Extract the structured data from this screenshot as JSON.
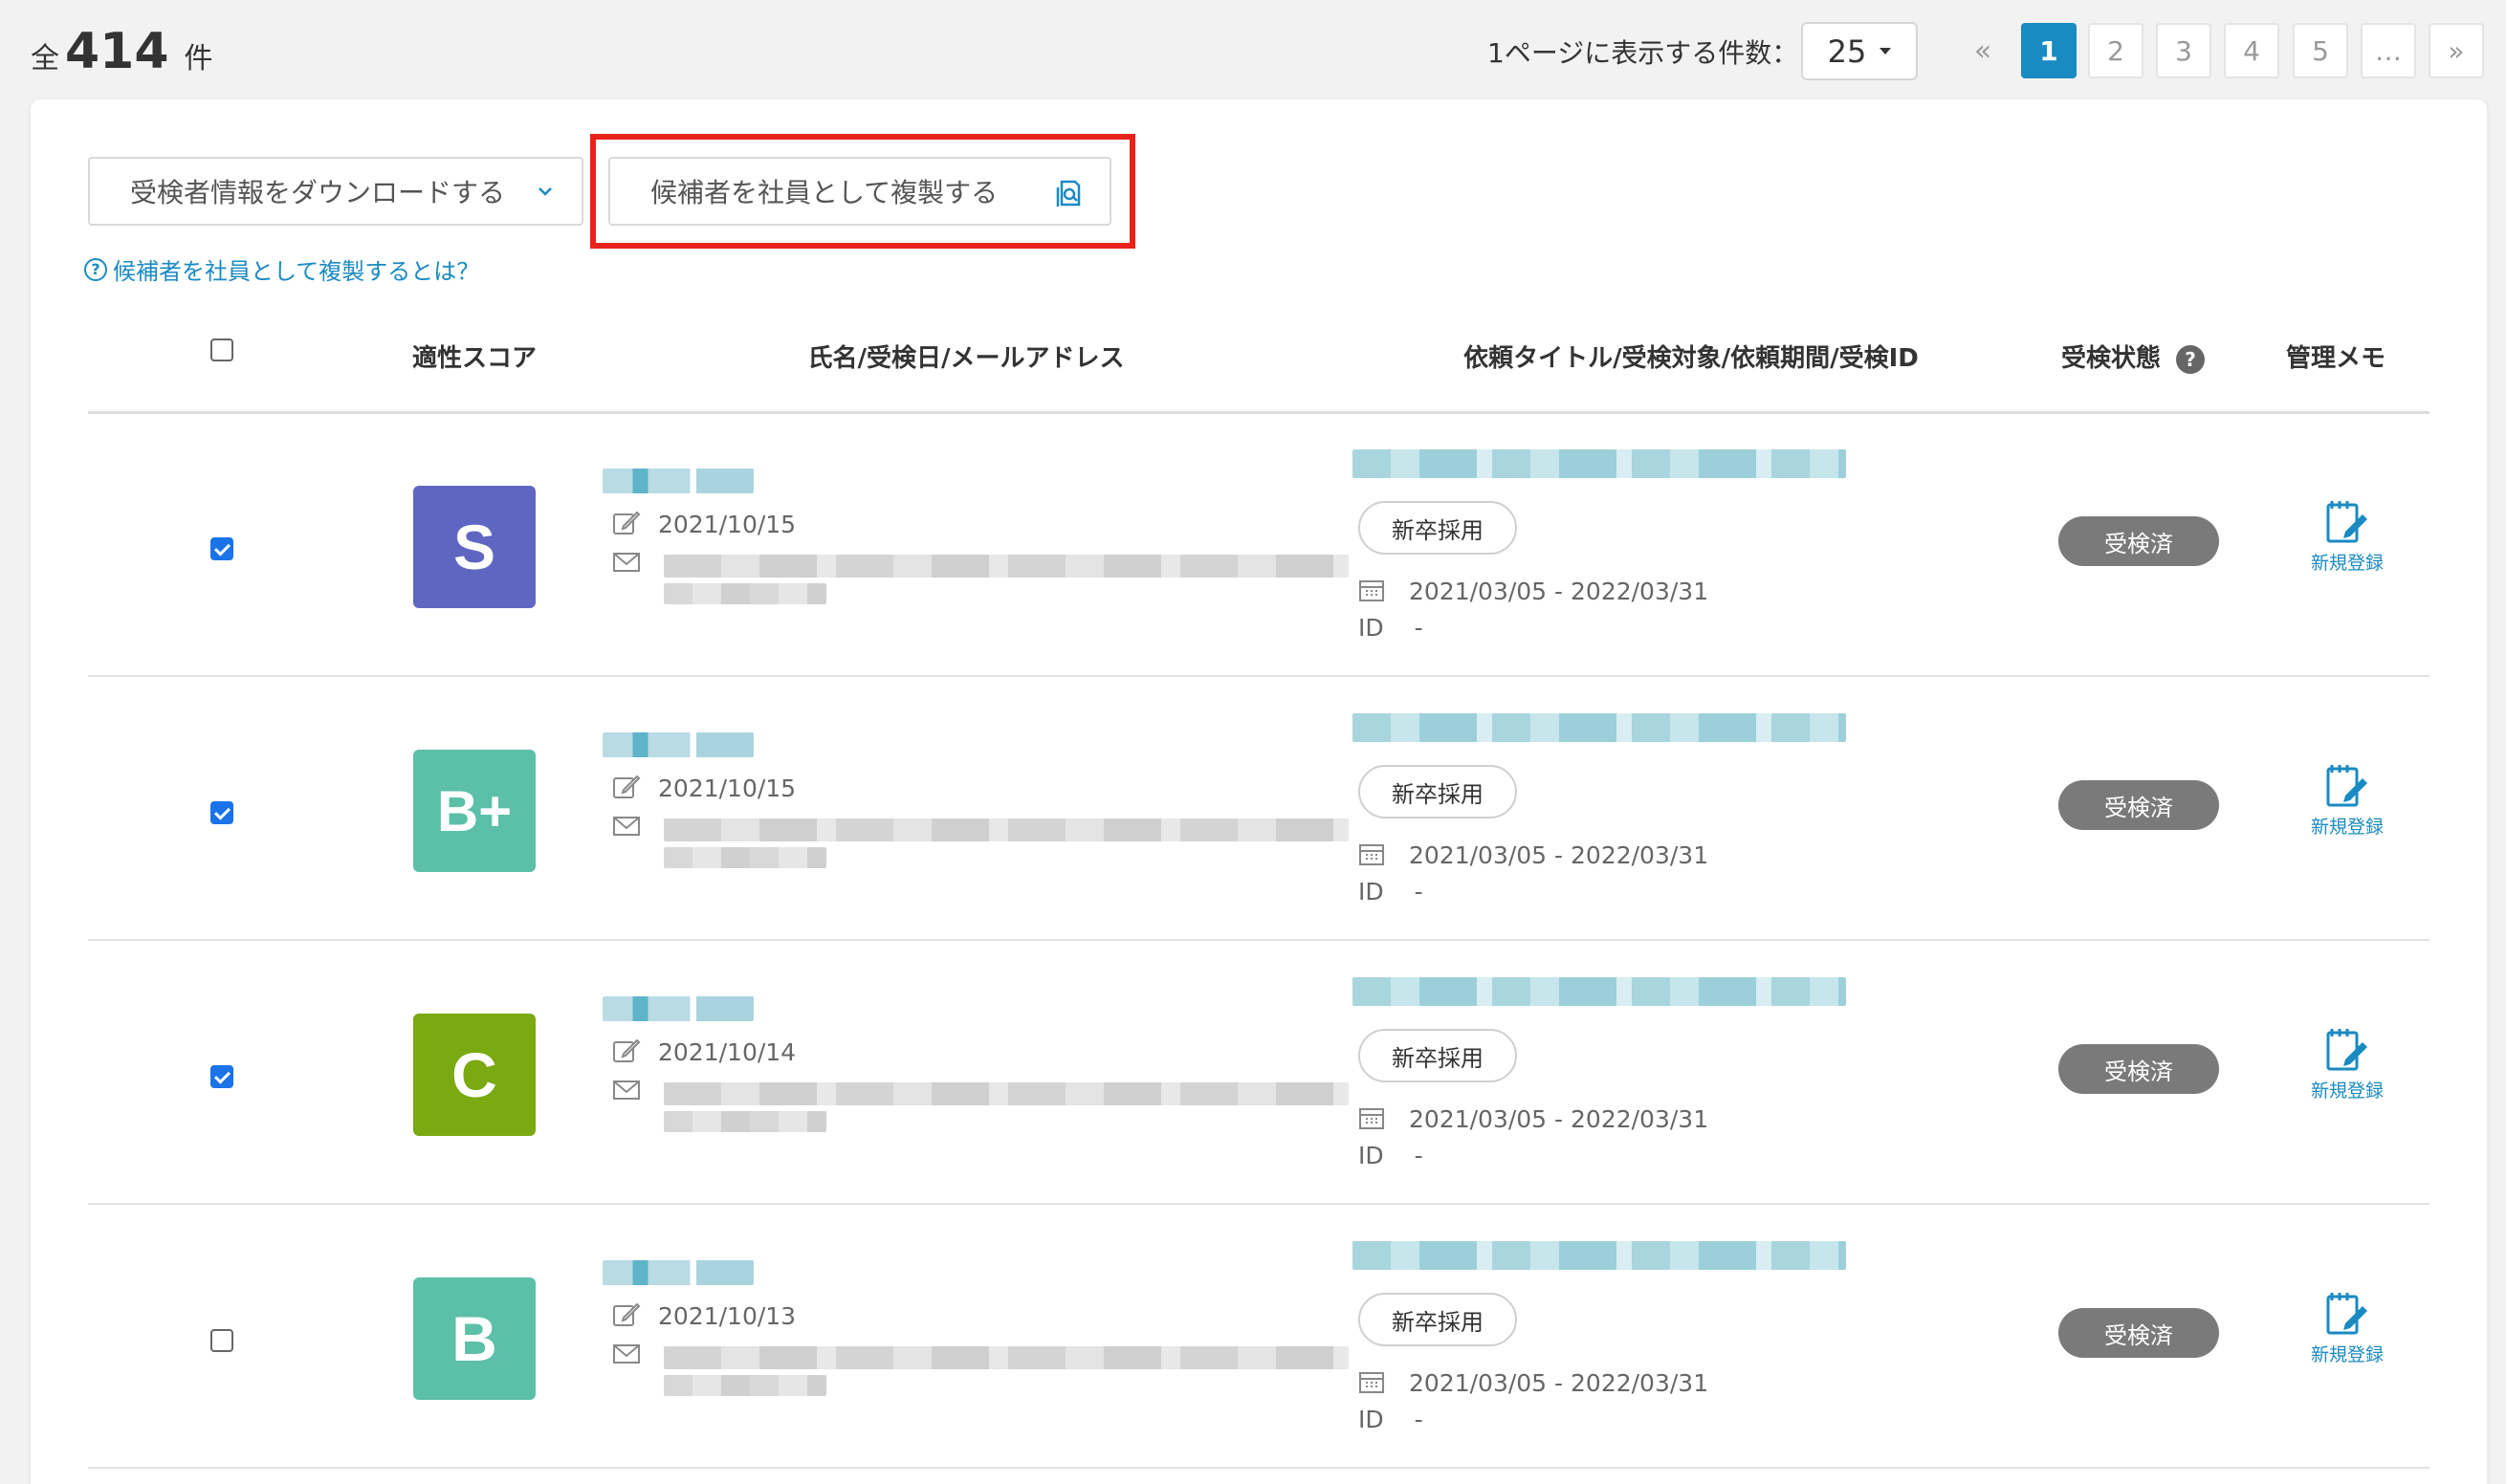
{
  "summary": {
    "prefix": "全",
    "count": "414",
    "suffix": "件"
  },
  "pagination": {
    "per_page_label": "1ページに表示する件数：",
    "per_page_value": "25",
    "first": "«",
    "pages": [
      "1",
      "2",
      "3",
      "4",
      "5"
    ],
    "active_page": "1",
    "ellipsis": "…",
    "last": "»"
  },
  "actions": {
    "download_label": "受検者情報をダウンロードする",
    "copy_label": "候補者を社員として複製する",
    "help_link": "候補者を社員として複製するとは？",
    "highlight_color": "#e8231b"
  },
  "table": {
    "headers": {
      "score": "適性スコア",
      "name": "氏名/受検日/メールアドレス",
      "request": "依頼タイトル/受検対象/依頼期間/受検ID",
      "status": "受検状態",
      "memo": "管理メモ"
    },
    "rows": [
      {
        "checked": true,
        "score": "S",
        "score_color": "#5f66c2",
        "date": "2021/10/15",
        "tag": "新卒採用",
        "period": "2021/03/05 - 2022/03/31",
        "id_label": "ID",
        "id_value": "-",
        "status": "受検済",
        "memo": "新規登録"
      },
      {
        "checked": true,
        "score": "B+",
        "score_color": "#5cbfa8",
        "date": "2021/10/15",
        "tag": "新卒採用",
        "period": "2021/03/05 - 2022/03/31",
        "id_label": "ID",
        "id_value": "-",
        "status": "受検済",
        "memo": "新規登録"
      },
      {
        "checked": true,
        "score": "C",
        "score_color": "#7aa912",
        "date": "2021/10/14",
        "tag": "新卒採用",
        "period": "2021/03/05 - 2022/03/31",
        "id_label": "ID",
        "id_value": "-",
        "status": "受検済",
        "memo": "新規登録"
      },
      {
        "checked": false,
        "score": "B",
        "score_color": "#5cbfa8",
        "date": "2021/10/13",
        "tag": "新卒採用",
        "period": "2021/03/05 - 2022/03/31",
        "id_label": "ID",
        "id_value": "-",
        "status": "受検済",
        "memo": "新規登録"
      }
    ]
  },
  "colors": {
    "accent": "#1a8ac2",
    "status_badge": "#7a7a7a"
  },
  "icons": {
    "copy": "copy-to-employee-icon",
    "chevron": "chevron-down-icon",
    "edit": "edit-icon",
    "mail": "mail-icon",
    "calendar": "calendar-icon",
    "memo": "memo-edit-icon",
    "help": "question-circle-icon"
  }
}
